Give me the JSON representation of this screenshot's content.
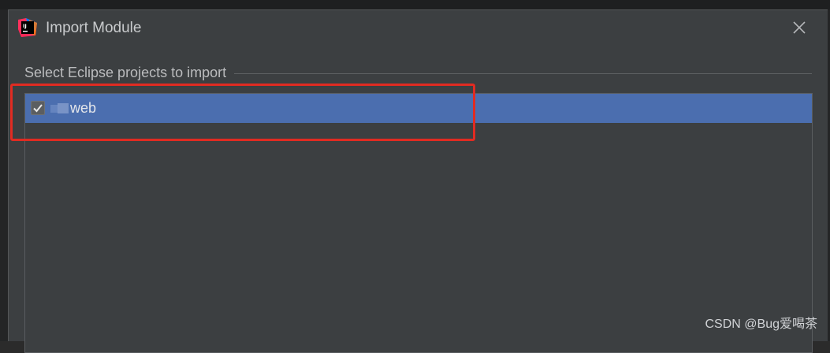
{
  "dialog": {
    "title": "Import Module",
    "app_icon": "intellij-idea-icon",
    "close_icon": "close-icon"
  },
  "group": {
    "label": "Select Eclipse projects to import"
  },
  "projects": [
    {
      "name": "web",
      "checked": true,
      "selected": true
    }
  ],
  "colors": {
    "dialog_bg": "#3c3f41",
    "selection_bg": "#4b6eaf",
    "annotation_red": "#e12b22",
    "text": "#bbbcbe"
  },
  "watermark": "CSDN @Bug爱喝茶"
}
